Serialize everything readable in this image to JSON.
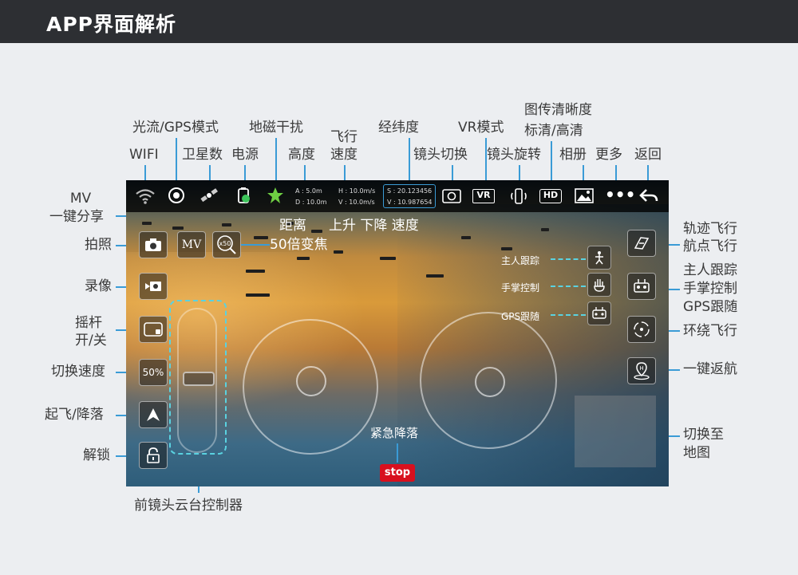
{
  "header": {
    "title": "APP界面解析"
  },
  "labels": {
    "wifi": "WIFI",
    "optical_gps": "光流/GPS模式",
    "satellites": "卫星数",
    "power": "电源",
    "geomagnetic": "地磁干扰",
    "height": "高度",
    "flight_speed_1": "飞行",
    "flight_speed_2": "速度",
    "lat_lon": "经纬度",
    "lens_switch": "镜头切换",
    "vr_mode": "VR模式",
    "lens_rotate": "镜头旋转",
    "image_quality_1": "图传清晰度",
    "image_quality_2": "标清/高清",
    "album": "相册",
    "more": "更多",
    "back": "返回",
    "mv_1": "MV",
    "mv_2": "一键分享",
    "photo": "拍照",
    "video": "录像",
    "joystick_1": "摇杆",
    "joystick_2": "开/关",
    "switch_speed": "切换速度",
    "takeoff_land": "起飞/降落",
    "unlock": "解锁",
    "gimbal": "前镜头云台控制器",
    "distance": "距离",
    "updown_speed": "上升 下降 速度",
    "zoom_50x": "50倍变焦",
    "track_1": "轨迹飞行",
    "track_2": "航点飞行",
    "follow_1": "主人跟踪",
    "follow_2": "手掌控制",
    "follow_3": "GPS跟随",
    "orbit": "环绕飞行",
    "return_home": "一键返航",
    "switch_map_1": "切换至",
    "switch_map_2": "地图",
    "emergency": "紧急降落"
  },
  "screen": {
    "telemetry": {
      "a": "A : 5.0m",
      "d": "D : 10.0m",
      "h": "H : 10.0m/s",
      "v": "V : 10.0m/s",
      "s": "S : 20.123456",
      "vv": "V : 10.987654"
    },
    "hd_label": "HD",
    "vr_label": "VR",
    "mv_label": "MV",
    "zoom_label": "x50",
    "speed_label": "50%",
    "stop_label": "stop",
    "follow_owner": "主人跟踪",
    "palm_control": "手掌控制",
    "gps_follow": "GPS跟随"
  },
  "colors": {
    "accent": "#3a9bd6",
    "dashed": "#5ad2e0",
    "stop": "#d8101e",
    "header": "#2d2f33"
  }
}
